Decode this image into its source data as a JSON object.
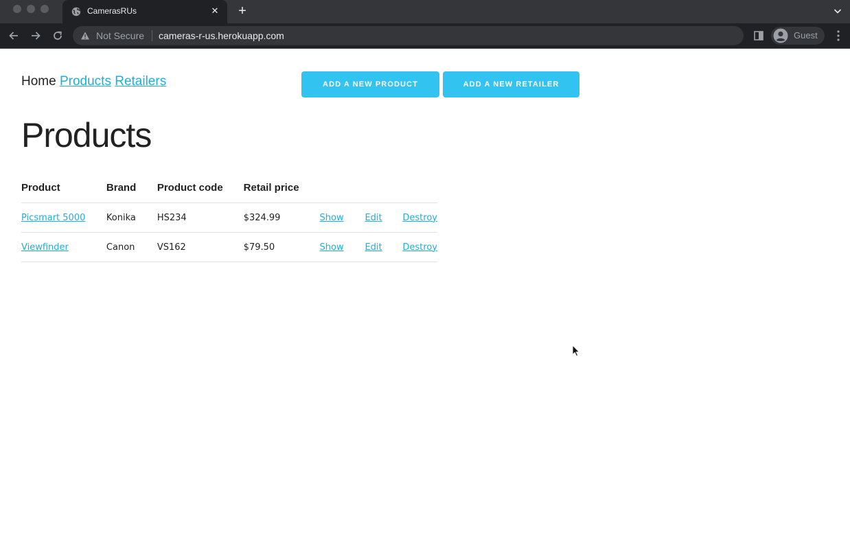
{
  "browser": {
    "tab": {
      "title": "CamerasRUs",
      "favicon": "globe-icon",
      "close_icon": "close-icon"
    },
    "new_tab_label": "+",
    "address_bar": {
      "security_text": "Not Secure",
      "url": "cameras-r-us.herokuapp.com"
    },
    "profile": {
      "name": "Guest"
    },
    "icons": [
      "back-arrow-icon",
      "forward-arrow-icon",
      "reload-icon",
      "warning-icon",
      "side-panel-icon",
      "avatar-icon",
      "kebab-menu-icon",
      "tab-search-chevron-icon"
    ]
  },
  "nav": {
    "home": "Home",
    "products": "Products",
    "retailers": "Retailers"
  },
  "actions": {
    "add_product": "Add a new product",
    "add_retailer": "Add a new retailer"
  },
  "page_title": "Products",
  "table": {
    "headers": [
      "Product",
      "Brand",
      "Product code",
      "Retail price",
      "",
      "",
      ""
    ],
    "rows": [
      {
        "product": "Picsmart 5000",
        "brand": "Konika",
        "code": "HS234",
        "price": "$324.99",
        "show": "Show",
        "edit": "Edit",
        "destroy": "Destroy"
      },
      {
        "product": "Viewfinder",
        "brand": "Canon",
        "code": "VS162",
        "price": "$79.50",
        "show": "Show",
        "edit": "Edit",
        "destroy": "Destroy"
      }
    ]
  },
  "colors": {
    "link": "#1eaedb",
    "button": "#33c3f0",
    "text": "#222222",
    "chrome_dark": "#202124"
  }
}
